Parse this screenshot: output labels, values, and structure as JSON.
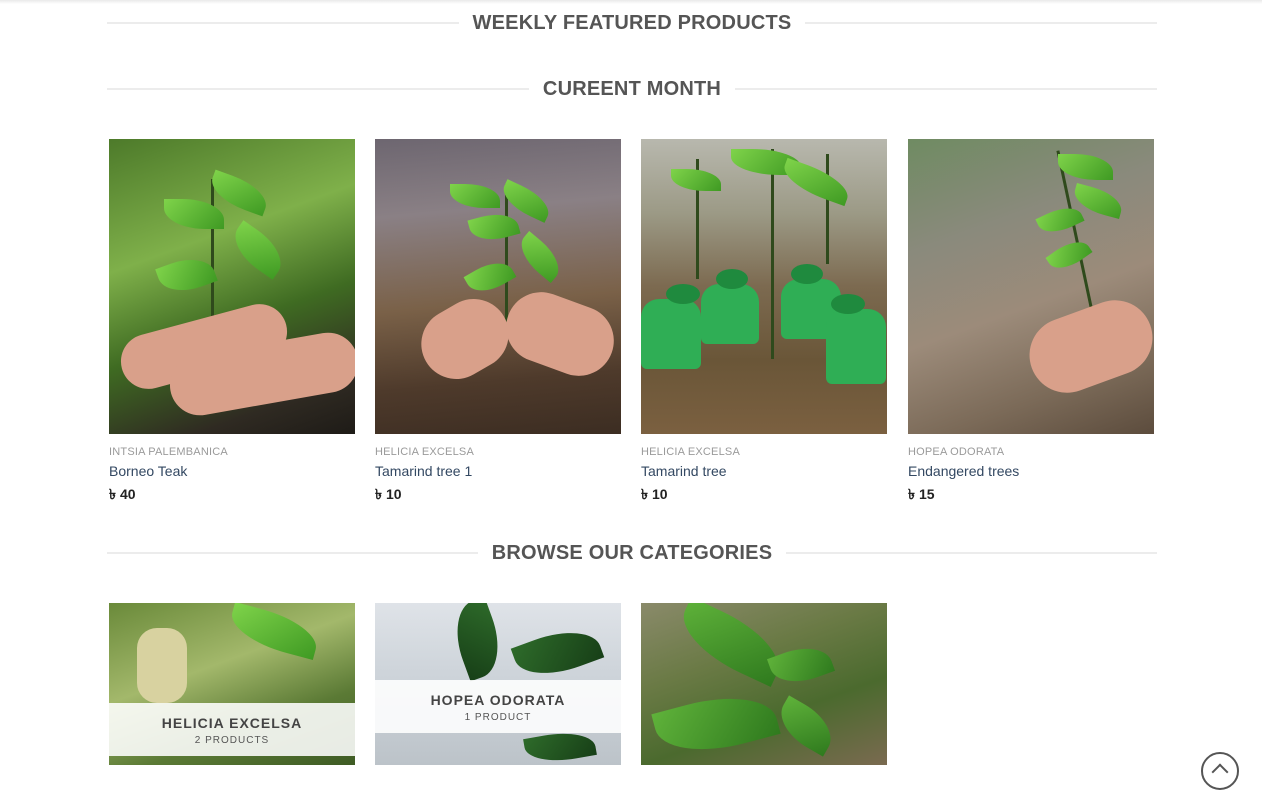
{
  "sections": {
    "weekly": "WEEKLY FEATURED PRODUCTS",
    "current": "CUREENT MONTH",
    "browse": "BROWSE OUR CATEGORIES"
  },
  "products": [
    {
      "category": "INTSIA PALEMBANICA",
      "name": "Borneo Teak",
      "currency": "৳",
      "price": "40"
    },
    {
      "category": "HELICIA EXCELSA",
      "name": "Tamarind tree 1",
      "currency": "৳",
      "price": "10"
    },
    {
      "category": "HELICIA EXCELSA",
      "name": "Tamarind tree",
      "currency": "৳",
      "price": "10"
    },
    {
      "category": "HOPEA ODORATA",
      "name": "Endangered trees",
      "currency": "৳",
      "price": "15"
    }
  ],
  "categories": [
    {
      "name": "HELICIA EXCELSA",
      "count": "2 PRODUCTS"
    },
    {
      "name": "HOPEA ODORATA",
      "count": "1 PRODUCT"
    },
    {
      "name": "",
      "count": ""
    }
  ],
  "icons": {
    "scroll_top": "chevron-up-icon"
  }
}
